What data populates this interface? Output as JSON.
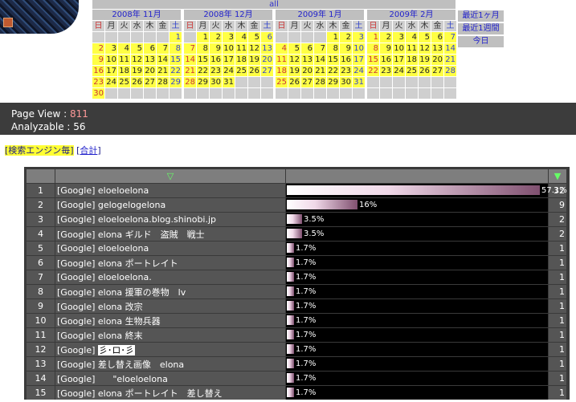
{
  "header": {
    "all_label": "all",
    "quick_links": [
      "最近1ヶ月",
      "最近1週間",
      "今日"
    ]
  },
  "weekdays": [
    "日",
    "月",
    "火",
    "水",
    "木",
    "金",
    "土"
  ],
  "calendars": [
    {
      "title": "2008年 11月",
      "offset": 6,
      "days": 30
    },
    {
      "title": "2008年 12月",
      "offset": 1,
      "days": 31
    },
    {
      "title": "2009年 1月",
      "offset": 4,
      "days": 31
    },
    {
      "title": "2009年 2月",
      "offset": 0,
      "days": 28
    }
  ],
  "stats": {
    "page_view_label": "Page View : ",
    "page_view_value": "811",
    "analyzable_label": "Analyzable : ",
    "analyzable_value": "56"
  },
  "mode": {
    "active": "検索エンジン毎",
    "other": "合計"
  },
  "table": {
    "sort_icon": "▽",
    "sort_icon_active": "▼",
    "rows": [
      {
        "rank": "1",
        "term": "[Google] eloeloelona",
        "pct": 57.1,
        "pct_label": "57.1%",
        "count": "32"
      },
      {
        "rank": "2",
        "term": "[Google] gelogelogelona",
        "pct": 16,
        "pct_label": "16%",
        "count": "9"
      },
      {
        "rank": "3",
        "term": "[Google] eloeloelona.blog.shinobi.jp",
        "pct": 3.5,
        "pct_label": "3.5%",
        "count": "2"
      },
      {
        "rank": "4",
        "term": "[Google] elona ギルド　盗賊　戦士",
        "pct": 3.5,
        "pct_label": "3.5%",
        "count": "2"
      },
      {
        "rank": "5",
        "term": "[Google] eloeloelona",
        "pct": 1.7,
        "pct_label": "1.7%",
        "count": "1"
      },
      {
        "rank": "6",
        "term": "[Google] elona ポートレイト",
        "pct": 1.7,
        "pct_label": "1.7%",
        "count": "1"
      },
      {
        "rank": "7",
        "term": "[Google] eloeloelona.",
        "pct": 1.7,
        "pct_label": "1.7%",
        "count": "1"
      },
      {
        "rank": "8",
        "term": "[Google] elona 援軍の巻物　lv",
        "pct": 1.7,
        "pct_label": "1.7%",
        "count": "1"
      },
      {
        "rank": "9",
        "term": "[Google] elona 改宗",
        "pct": 1.7,
        "pct_label": "1.7%",
        "count": "1"
      },
      {
        "rank": "10",
        "term": "[Google] elona 生物兵器",
        "pct": 1.7,
        "pct_label": "1.7%",
        "count": "1"
      },
      {
        "rank": "11",
        "term": "[Google] elona 終末",
        "pct": 1.7,
        "pct_label": "1.7%",
        "count": "1"
      },
      {
        "rank": "12",
        "term": "[Google] ",
        "term_box": "彡･ロ･彡",
        "pct": 1.7,
        "pct_label": "1.7%",
        "count": "1"
      },
      {
        "rank": "13",
        "term": "[Google] 差し替え画像　elona",
        "pct": 1.7,
        "pct_label": "1.7%",
        "count": "1"
      },
      {
        "rank": "14",
        "term": "[Google]　　\"eloeloelona",
        "pct": 1.7,
        "pct_label": "1.7%",
        "count": "1"
      },
      {
        "rank": "15",
        "term": "[Google] elona ポートレイト　差し替え",
        "pct": 1.7,
        "pct_label": "1.7%",
        "count": "1"
      }
    ]
  }
}
